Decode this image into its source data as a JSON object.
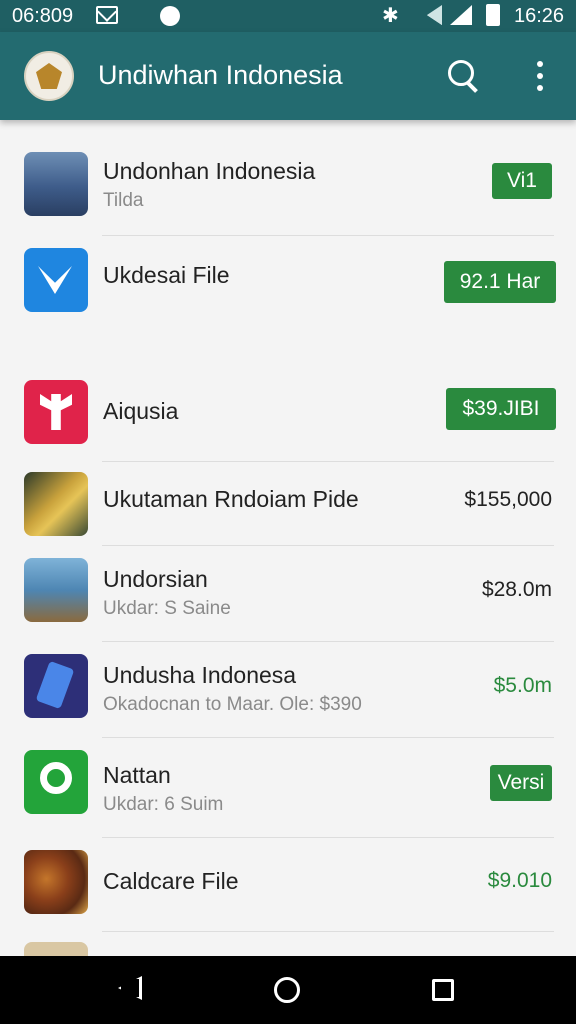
{
  "status_bar": {
    "time_left": "06:809",
    "time_right": "16:26"
  },
  "app_bar": {
    "title": "Undiwhan Indonesia"
  },
  "icons": {
    "mail": "mail-icon",
    "search": "search-icon",
    "more": "more-vert-icon",
    "back": "back-icon",
    "home": "home-icon",
    "recent": "recent-apps-icon"
  },
  "colors": {
    "app_bar": "#236b70",
    "status_bar": "#1f5f63",
    "badge": "#2a8a3e",
    "green_price": "#2a8a3e"
  },
  "items": [
    {
      "title": "Undonhan Indonesia",
      "subtitle": "Tilda",
      "badge": "Vi1"
    },
    {
      "title": "Ukdesai File",
      "badge": "92.1 Har"
    },
    {
      "title": "Aiqusia",
      "badge": "$39.JIBI"
    },
    {
      "title": "Ukutaman Rndoiam Pide",
      "price": "$155,000"
    },
    {
      "title": "Undorsian",
      "subtitle": "Ukdar: S Saine",
      "price": "$28.0m"
    },
    {
      "title": "Undusha Indonesa",
      "subtitle": "Okadocnan to Maar. Ole: $390",
      "price": "$5.0m"
    },
    {
      "title": "Nattan",
      "subtitle": "Ukdar: 6 Suim",
      "badge": "Versi"
    },
    {
      "title": "Caldcare File",
      "price": "$9.010"
    }
  ]
}
